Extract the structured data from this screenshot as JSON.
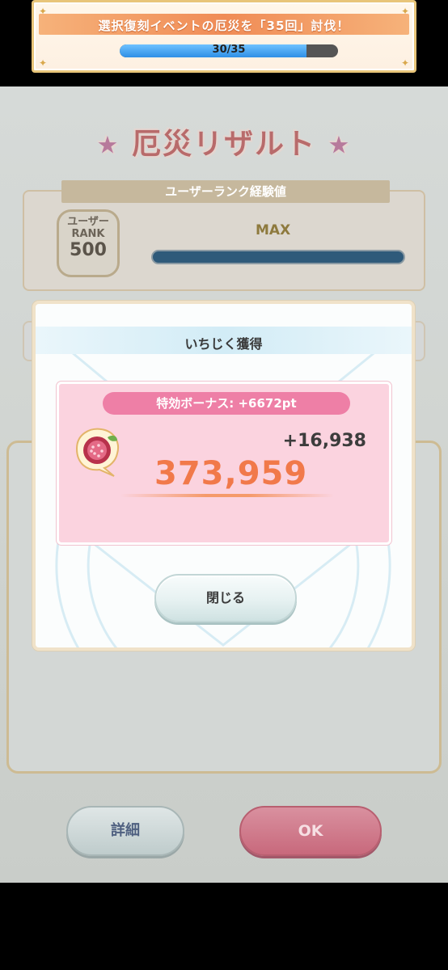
{
  "mission": {
    "title": "選択復刻イベントの厄災を「35回」討伐！",
    "progress_text": "30/35",
    "progress_fraction": 0.857
  },
  "result": {
    "heading": "厄災リザルト",
    "rank_section_label": "ユーザーランク経験値",
    "rank_badge_label": "ユーザー RANK",
    "rank_value": "500",
    "rank_status": "MAX"
  },
  "buttons": {
    "details": "詳細",
    "ok": "OK"
  },
  "modal": {
    "title": "いちじく獲得",
    "bonus_label": "特効ボーナス: +6672pt",
    "gain": "+16,938",
    "total": "373,959",
    "close": "閉じる",
    "item_icon": "fig-icon"
  },
  "colors": {
    "accent_orange": "#f1794a",
    "bonus_pink": "#ee7fa6",
    "card_pink": "#fbd3df",
    "progress_blue": "#2e8fe6"
  }
}
